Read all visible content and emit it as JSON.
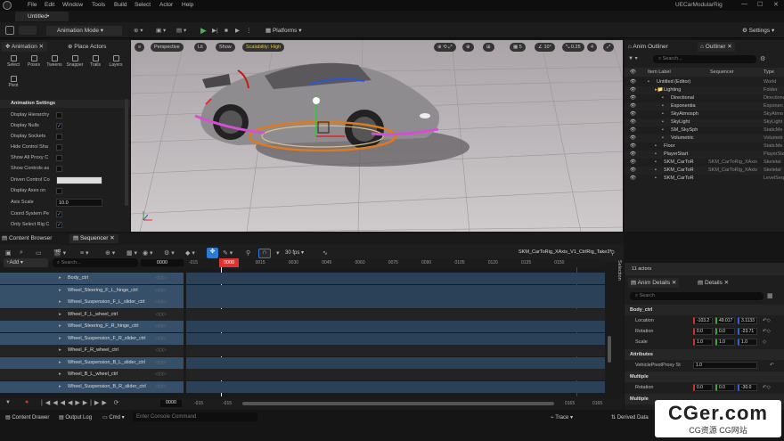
{
  "app": {
    "title": "UECarModularRig",
    "doc_tab": "Untitled•"
  },
  "menu": [
    "File",
    "Edit",
    "Window",
    "Tools",
    "Build",
    "Select",
    "Actor",
    "Help"
  ],
  "toolbar": {
    "mode": "Animation Mode",
    "platforms": "Platforms",
    "settings": "Settings"
  },
  "left": {
    "tab1": "Animation",
    "tab2": "Place Actors",
    "modes": [
      "Select",
      "Poses",
      "Tweens",
      "Snapper",
      "Trails",
      "Layers",
      "Pivot"
    ],
    "section": "Animation Settings",
    "rows": [
      {
        "label": "Display Hierarchy",
        "check": ""
      },
      {
        "label": "Display Nulls",
        "check": "✓"
      },
      {
        "label": "Display Sockets",
        "check": ""
      },
      {
        "label": "Hide Control Sha",
        "check": ""
      },
      {
        "label": "Show All Proxy C",
        "check": ""
      },
      {
        "label": "Show Controls as",
        "check": ""
      }
    ],
    "driven": "Driven Control Co",
    "after": [
      {
        "label": "Display Axes on",
        "check": ""
      }
    ],
    "axis_label": "Axis Scale",
    "axis_value": "10.0",
    "coord_label": "Coord System Pe",
    "coord_check": "✓",
    "only_label": "Only Select Rig C",
    "only_check": "✓"
  },
  "viewport": {
    "perspective": "Perspective",
    "lit": "Lit",
    "show": "Show",
    "scalability": "Scalability: High",
    "snap_num": "5",
    "angle": "10°",
    "scale": "0.25",
    "cam": "4"
  },
  "outliner": {
    "tab1": "Anim Outliner",
    "tab2": "Outliner",
    "search": "Search...",
    "col_label": "Item Label",
    "col_seq": "Sequencer",
    "col_type": "Type",
    "rows": [
      {
        "indent": 0,
        "name": "Untitled (Editor)",
        "cls": "",
        "type": "World"
      },
      {
        "indent": 1,
        "name": "Lighting",
        "cls": "",
        "type": "Folder"
      },
      {
        "indent": 2,
        "name": "Directional",
        "cls": "",
        "type": "Directiona"
      },
      {
        "indent": 2,
        "name": "Exponentia",
        "cls": "",
        "type": "Exponen"
      },
      {
        "indent": 2,
        "name": "SkyAtmosph",
        "cls": "",
        "type": "SkyAtmo"
      },
      {
        "indent": 2,
        "name": "SkyLight",
        "cls": "",
        "type": "SkyLight"
      },
      {
        "indent": 2,
        "name": "SM_SkySph",
        "cls": "",
        "type": "StaticMe"
      },
      {
        "indent": 2,
        "name": "Volumetric",
        "cls": "",
        "type": "Volumetr"
      },
      {
        "indent": 1,
        "name": "Floor",
        "cls": "",
        "type": "StaticMe"
      },
      {
        "indent": 1,
        "name": "PlayerStart",
        "cls": "",
        "type": "PlayerSta"
      },
      {
        "indent": 1,
        "name": "SKM_CarToR",
        "cls": "SKM_CarToRig_XAxis",
        "type": "Skeletal"
      },
      {
        "indent": 1,
        "name": "SKM_CarToR",
        "cls": "SKM_CarToRig_XAxis",
        "type": "Skeletal"
      },
      {
        "indent": 1,
        "name": "SKM_CarToR",
        "cls": "",
        "type": "LevelSeq"
      }
    ]
  },
  "sequencer": {
    "tab1": "Content Browser",
    "tab2": "Sequencer",
    "fps": "30 fps",
    "seq_name": "SKM_CarToRig_XAxis_V1_CtrlRig_Take3*",
    "add": "Add",
    "search": "Search...",
    "frame": "0000",
    "ticks": [
      "-015",
      "0000",
      "0015",
      "0030",
      "0045",
      "0060",
      "0075",
      "0090",
      "0105",
      "0120",
      "0135",
      "0150"
    ],
    "tracks": [
      {
        "name": "Body_ctrl",
        "hi": true
      },
      {
        "name": "Wheel_Steering_F_L_hinge_ctrl",
        "hi": true
      },
      {
        "name": "Wheel_Suspension_F_L_slider_ctrl",
        "hi": true
      },
      {
        "name": "Wheel_F_L_wheel_ctrl",
        "hi": false
      },
      {
        "name": "Wheel_Steering_F_R_hinge_ctrl",
        "hi": true
      },
      {
        "name": "Wheel_Suspension_F_R_slider_ctrl",
        "hi": true
      },
      {
        "name": "Wheel_F_R_wheel_ctrl",
        "hi": false
      },
      {
        "name": "Wheel_Suspension_B_L_slider_ctrl",
        "hi": true
      },
      {
        "name": "Wheel_B_L_wheel_ctrl",
        "hi": false
      },
      {
        "name": "Wheel_Suspension_B_R_slider_ctrl",
        "hi": true
      }
    ],
    "bottom": {
      "left1": "-015",
      "left2": "-015",
      "frame": "0000",
      "right1": "0165",
      "right2": "0165"
    },
    "selection": "Selection"
  },
  "details": {
    "actors": "11 actors",
    "tab1": "Anim Details",
    "tab2": "Details",
    "search": "Search",
    "body": "Body_ctrl",
    "location": {
      "label": "Location",
      "x": "-103.2",
      "y": "49.017",
      "z": "3.1133"
    },
    "rotation": {
      "label": "Rotation",
      "x": "0.0",
      "y": "0.0",
      "z": "-23.71"
    },
    "scale": {
      "label": "Scale",
      "x": "1.0",
      "y": "1.0",
      "z": "1.0"
    },
    "attributes": "Attributes",
    "proxy_label": "VehiclePivotProxy St",
    "proxy_value": "1.0",
    "multiple": "Multiple",
    "mrot": {
      "label": "Rotation",
      "x": "0.0",
      "y": "0.0",
      "z": "-30.0"
    },
    "multiple2": "Multiple"
  },
  "status": {
    "drawer": "Content Drawer",
    "output": "Output Log",
    "cmd": "Cmd",
    "console": "Enter Console Command",
    "trace": "Trace",
    "derived": "Derived Data"
  },
  "watermark": {
    "line1": "CGer.com",
    "line2": "CG资源 CG网站"
  }
}
